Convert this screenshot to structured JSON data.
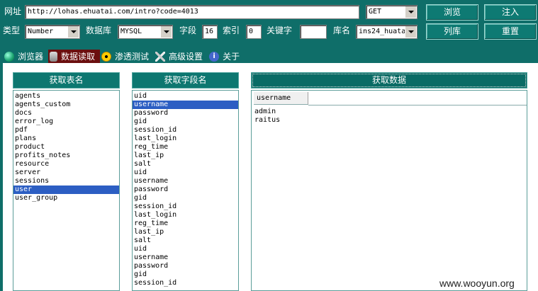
{
  "toolbar": {
    "url_label": "网址",
    "url_value": "http://lohas.ehuatai.com/intro?code=4013",
    "method_value": "GET",
    "browse_btn": "浏览",
    "inject_btn": "注入",
    "type_label": "类型",
    "type_value": "Number",
    "db_label": "数据库",
    "db_value": "MYSQL",
    "field_label": "字段",
    "field_value": "16",
    "index_label": "索引",
    "index_value": "0",
    "keyword_label": "关键字",
    "keyword_value": "",
    "lib_label": "库名",
    "lib_value": "ins24_huata",
    "list_btn": "列库",
    "reset_btn": "重置"
  },
  "tabs": [
    {
      "label": "浏览器",
      "icon": "globe-icon"
    },
    {
      "label": "数据读取",
      "icon": "database-icon"
    },
    {
      "label": "渗透测试",
      "icon": "radiation-icon"
    },
    {
      "label": "高级设置",
      "icon": "tools-icon"
    },
    {
      "label": "关于",
      "icon": "info-icon"
    }
  ],
  "panels": {
    "tables_header": "获取表名",
    "fields_header": "获取字段名",
    "data_header": "获取数据"
  },
  "tables": [
    "agents",
    "agents_custom",
    "docs",
    "error_log",
    "pdf",
    "plans",
    "product",
    "profits_notes",
    "resource",
    "server",
    "sessions",
    "user",
    "user_group"
  ],
  "selected_table": "user",
  "fields": [
    "uid",
    "username",
    "password",
    "gid",
    "session_id",
    "last_login",
    "reg_time",
    "last_ip",
    "salt",
    "uid",
    "username",
    "password",
    "gid",
    "session_id",
    "last_login",
    "reg_time",
    "last_ip",
    "salt",
    "uid",
    "username",
    "password",
    "gid",
    "session_id"
  ],
  "data_grid": {
    "column": "username",
    "rows": [
      "admin",
      "raitus"
    ]
  },
  "watermark": "www.wooyun.org",
  "colors": {
    "background": "#0f6e69",
    "active_tab": "#6b0f0f",
    "selection": "#2c5ec3"
  }
}
